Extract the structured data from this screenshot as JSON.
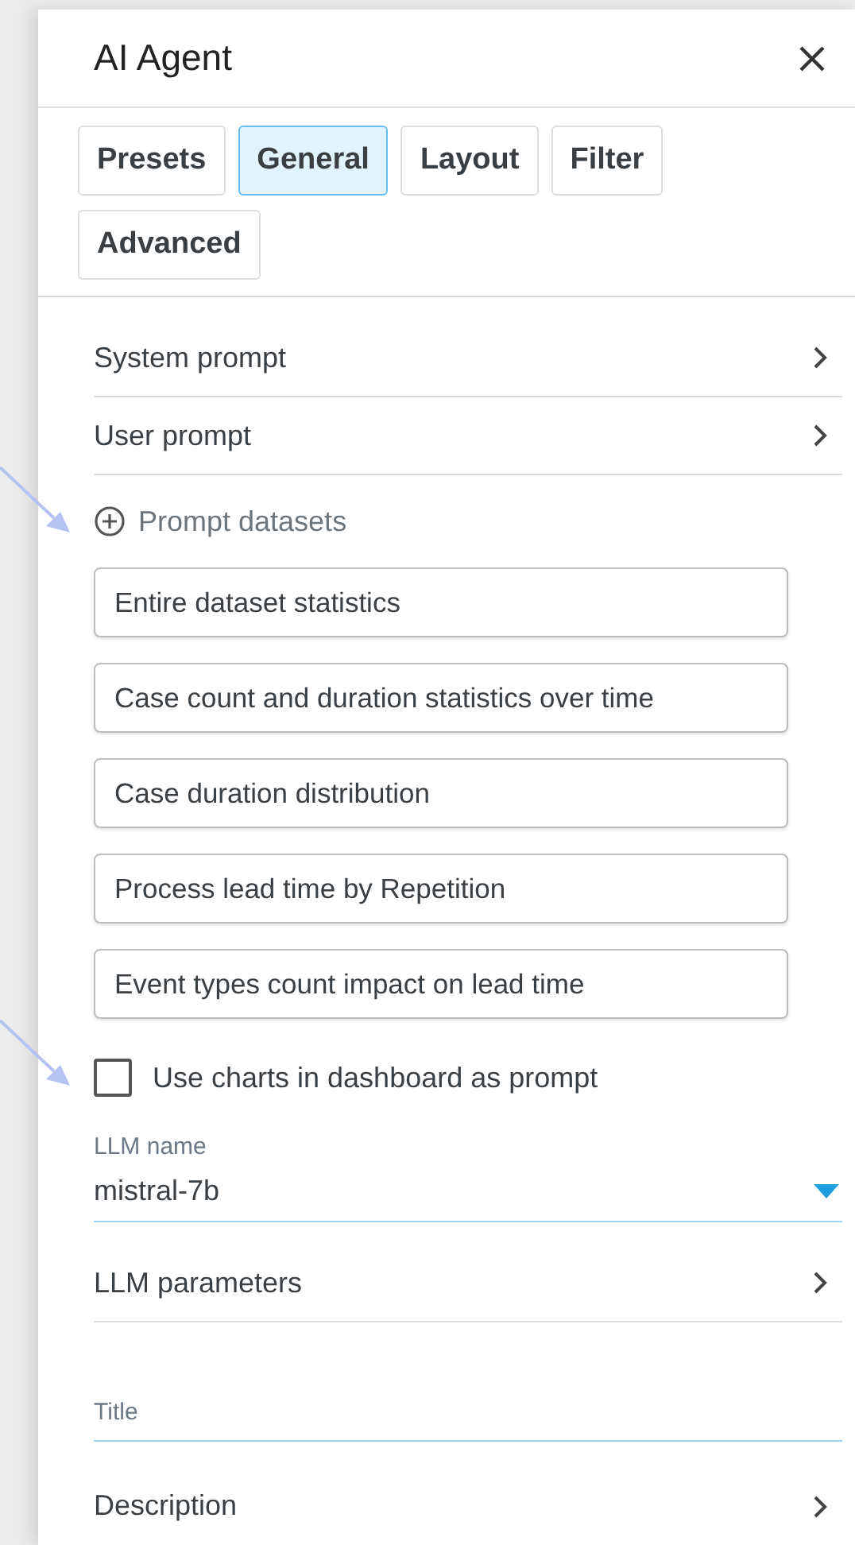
{
  "panel": {
    "title": "AI Agent"
  },
  "tabs": [
    {
      "label": "Presets",
      "selected": false
    },
    {
      "label": "General",
      "selected": true
    },
    {
      "label": "Layout",
      "selected": false
    },
    {
      "label": "Filter",
      "selected": false
    },
    {
      "label": "Advanced",
      "selected": false
    }
  ],
  "sections": [
    {
      "label": "System prompt"
    },
    {
      "label": "User prompt"
    }
  ],
  "prompt_datasets": {
    "label": "Prompt datasets",
    "items": [
      "Entire dataset statistics",
      "Case count and duration statistics over time",
      "Case duration distribution",
      "Process lead time by Repetition",
      "Event types count impact on lead time"
    ]
  },
  "use_charts": {
    "label": "Use charts in dashboard as prompt",
    "checked": false
  },
  "llm_name": {
    "label": "LLM name",
    "value": "mistral-7b"
  },
  "llm_parameters": {
    "label": "LLM parameters"
  },
  "title_field": {
    "placeholder": "Title"
  },
  "description": {
    "label": "Description"
  }
}
